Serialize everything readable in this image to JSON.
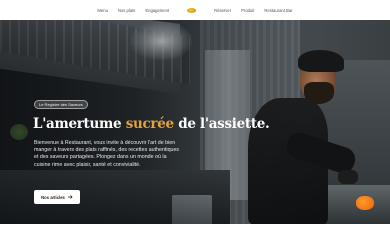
{
  "nav": {
    "left_items": [
      "Menu",
      "Nos plats",
      "Engagement"
    ],
    "logo_icon": "brand-logo-icon",
    "right_items": [
      "Réserver",
      "Produit",
      "Restaurant Bar"
    ]
  },
  "hero": {
    "badge": "Le Registre des Saveurs",
    "headline_part1": "L'amertume ",
    "headline_accent": "sucrée",
    "headline_part2": " de l'assiette.",
    "description": "Bienvenue à Restaurant, vous invite à découvrir l'art de bien manger à travers des plats raffinés, des recettes authentiques et des saveurs partagées. Plongez dans un monde où la cuisine rime avec plaisir, santé et convivialité.",
    "cta_label": "Nos articles",
    "cta_icon": "arrow-right-icon",
    "accent_color": "#e6a33a"
  }
}
